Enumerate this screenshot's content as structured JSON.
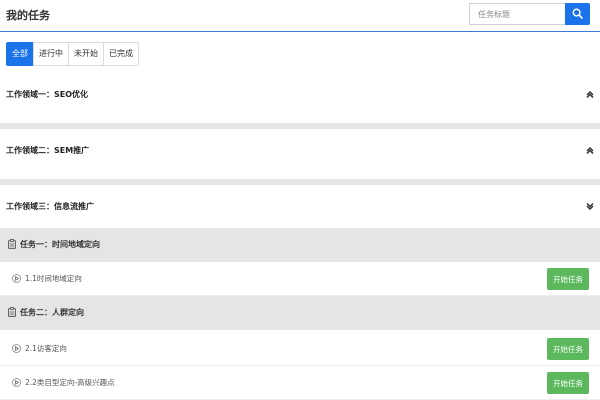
{
  "header": {
    "title": "我的任务",
    "search_placeholder": "任务标题",
    "search_icon": "search-icon"
  },
  "tabs": [
    {
      "label": "全部",
      "active": true
    },
    {
      "label": "进行中",
      "active": false
    },
    {
      "label": "未开始",
      "active": false
    },
    {
      "label": "已完成",
      "active": false
    }
  ],
  "sections": [
    {
      "title": "工作领域一：SEO优化",
      "expanded": false,
      "chevron": "chevron-up-icon"
    },
    {
      "title": "工作领域二：SEM推广",
      "expanded": false,
      "chevron": "chevron-up-icon"
    },
    {
      "title": "工作领域三：信息流推广",
      "expanded": true,
      "chevron": "chevron-down-icon"
    }
  ],
  "tasks": [
    {
      "title": "任务一：时间地域定向",
      "icon": "clipboard-icon",
      "subtasks": [
        {
          "label": "1.1时间地域定向",
          "button": "开始任务"
        }
      ]
    },
    {
      "title": "任务二：人群定向",
      "icon": "clipboard-icon",
      "subtasks": [
        {
          "label": "2.1访客定向",
          "button": "开始任务"
        },
        {
          "label": "2.2类目型定向-高级兴趣点",
          "button": "开始任务"
        }
      ]
    }
  ],
  "colors": {
    "primary": "#1a73e8",
    "success": "#5cb85c",
    "divider": "#e6e6e6",
    "task_header_bg": "#e5e5e5"
  }
}
